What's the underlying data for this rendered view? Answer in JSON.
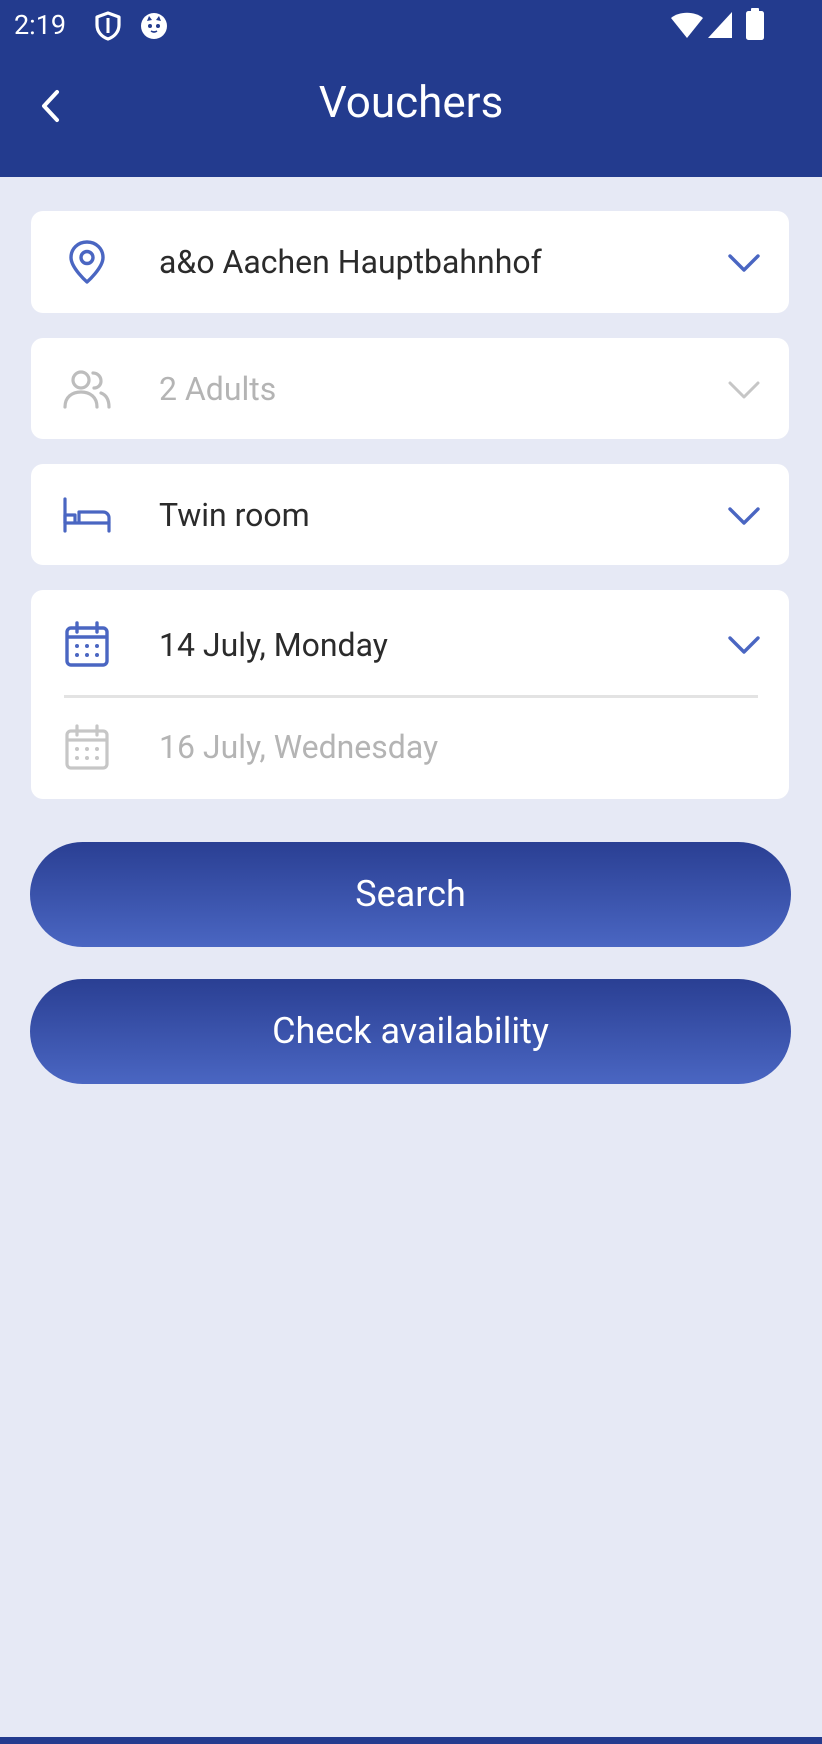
{
  "status_bar": {
    "time": "2:19",
    "icons": [
      "shield-icon",
      "cat-face-icon",
      "wifi-icon",
      "cellular-icon",
      "battery-icon"
    ]
  },
  "toolbar": {
    "title": "Vouchers",
    "back_icon": "chevron-left-icon"
  },
  "form": {
    "hostel": {
      "value": "a&o Aachen Hauptbahnhof",
      "icon": "location-pin-icon",
      "enabled": true
    },
    "guests": {
      "value": "2 Adults",
      "icon": "people-icon",
      "enabled": false
    },
    "room": {
      "value": "Twin room",
      "icon": "bed-icon",
      "enabled": true
    },
    "check_in": {
      "value": "14 July, Monday",
      "icon": "calendar-icon",
      "enabled": true
    },
    "check_out": {
      "value": "16 July, Wednesday",
      "icon": "calendar-icon",
      "enabled": false
    }
  },
  "buttons": {
    "search": "Search",
    "check_availability": "Check availability"
  },
  "colors": {
    "primary": "#233b8e",
    "accent": "#4a66c2",
    "background": "#e6e9f5",
    "muted": "#b4b4b4"
  }
}
